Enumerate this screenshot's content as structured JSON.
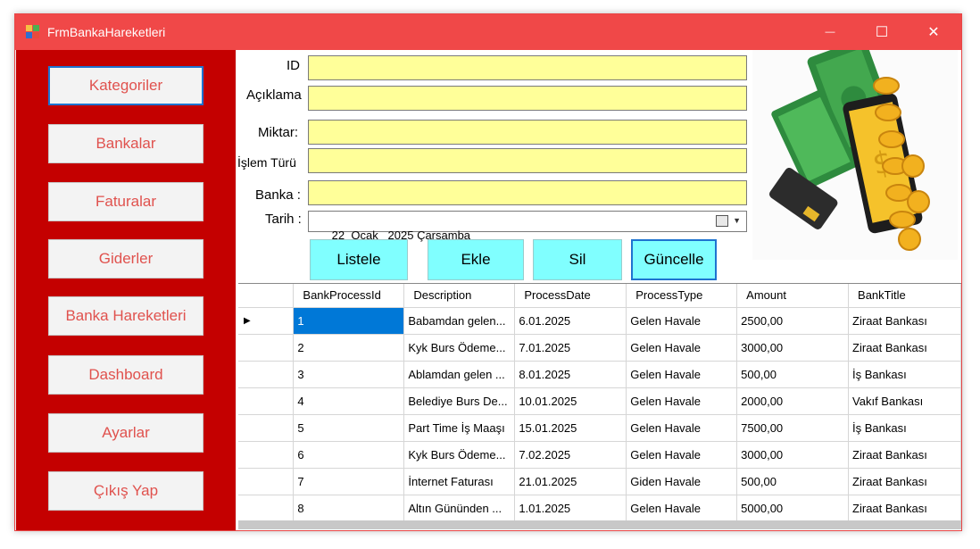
{
  "window": {
    "title": "FrmBankaHareketleri",
    "minimize_glyph": "—",
    "maximize_glyph": "☐",
    "close_glyph": "✕"
  },
  "sidebar": {
    "items": [
      {
        "label": "Kategoriler"
      },
      {
        "label": "Bankalar"
      },
      {
        "label": "Faturalar"
      },
      {
        "label": "Giderler"
      },
      {
        "label": "Banka Hareketleri"
      },
      {
        "label": "Dashboard"
      },
      {
        "label": "Ayarlar"
      },
      {
        "label": "Çıkış Yap"
      }
    ]
  },
  "form": {
    "id_label": "ID",
    "aciklama_label": "Açıklama",
    "miktar_label": "Miktar:",
    "islem_turu_label": "İşlem Türü",
    "banka_label": "Banka :",
    "tarih_label": "Tarih :",
    "id_value": "",
    "aciklama_value": "",
    "miktar_value": "",
    "islem_turu_value": "",
    "banka_value": "",
    "tarih_value": "22  Ocak   2025 Çarşamba"
  },
  "actions": {
    "listele": "Listele",
    "ekle": "Ekle",
    "sil": "Sil",
    "guncelle": "Güncelle"
  },
  "grid": {
    "columns": [
      "BankProcessId",
      "Description",
      "ProcessDate",
      "ProcessType",
      "Amount",
      "BankTitle"
    ],
    "rows": [
      [
        "1",
        "Babamdan gelen...",
        "6.01.2025",
        "Gelen Havale",
        "2500,00",
        "Ziraat Bankası"
      ],
      [
        "2",
        "Kyk Burs Ödeme...",
        "7.01.2025",
        "Gelen Havale",
        "3000,00",
        "Ziraat Bankası"
      ],
      [
        "3",
        "Ablamdan gelen ...",
        "8.01.2025",
        "Gelen Havale",
        "500,00",
        "İş Bankası"
      ],
      [
        "4",
        "Belediye Burs De...",
        "10.01.2025",
        "Gelen Havale",
        "2000,00",
        "Vakıf Bankası"
      ],
      [
        "5",
        "Part Time İş Maaşı",
        "15.01.2025",
        "Gelen Havale",
        "7500,00",
        "İş Bankası"
      ],
      [
        "6",
        "Kyk Burs Ödeme...",
        "7.02.2025",
        "Gelen Havale",
        "3000,00",
        "Ziraat Bankası"
      ],
      [
        "7",
        "İnternet Faturası",
        "21.01.2025",
        "Giden Havale",
        "500,00",
        "Ziraat Bankası"
      ],
      [
        "8",
        "Altın Gününden ...",
        "1.01.2025",
        "Gelen Havale",
        "5000,00",
        "Ziraat Bankası"
      ]
    ],
    "selected_row_marker": "▶"
  },
  "colors": {
    "titlebar": "#f04848",
    "sidebar": "#c40000",
    "field": "#ffff99",
    "action_button": "#80ffff",
    "nav_text": "#e0524e",
    "selection": "#0078d7"
  }
}
